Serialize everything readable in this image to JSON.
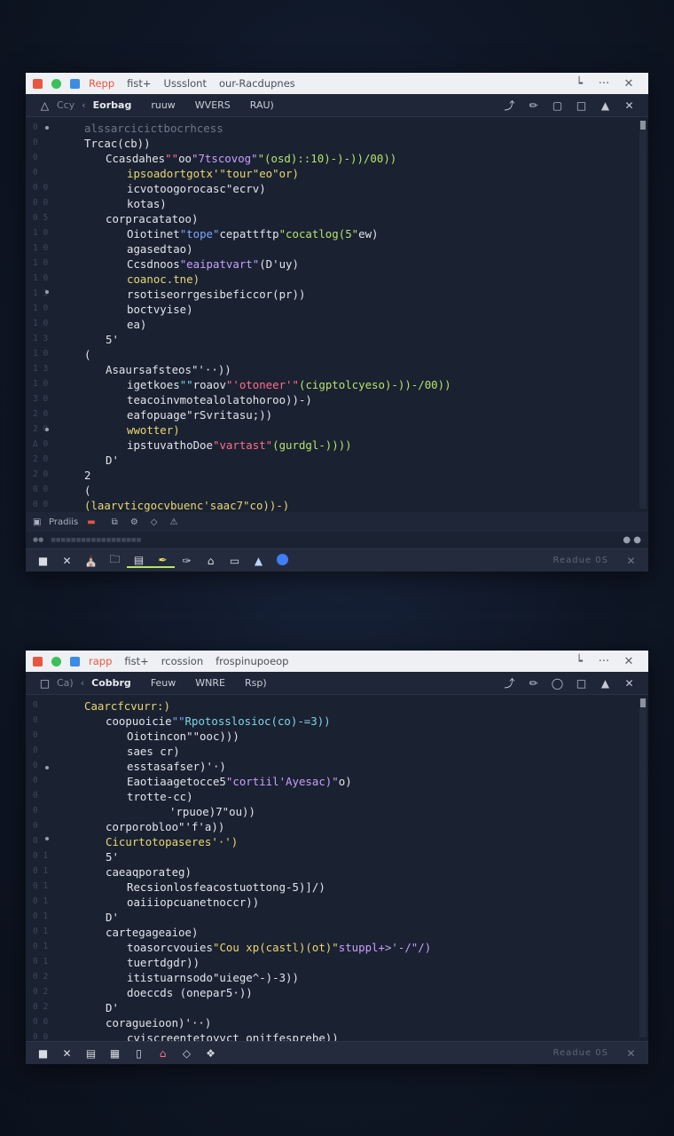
{
  "colors": {
    "background": "#0f1726",
    "titlebar": "#eef0f3",
    "editor": "#1a2131",
    "accent_blue": "#3f7ef5",
    "tab_red": "#e8563f",
    "tab_green": "#3cc05a",
    "tab_blue": "#3a8de0"
  },
  "window1": {
    "titlebar": {
      "tab1": "Repp",
      "tab2": "fist+",
      "tab3": "Ussslont",
      "tab4": "our-Racdupnes",
      "icons": [
        "minimize-icon",
        "more-icon",
        "close-icon"
      ]
    },
    "toolbar": {
      "item0": "Ccy",
      "item1": "Eorbag",
      "item2": "ruuw",
      "item3": "WVERS",
      "item4": "RAU)",
      "icons": [
        "arrow-icon",
        "brush-icon",
        "square-icon",
        "window-icon",
        "bell-icon",
        "close-icon"
      ]
    },
    "code": [
      {
        "indent": 0,
        "text": "alssarcicictbocrhcess",
        "cls": "c-dim"
      },
      {
        "indent": 0,
        "text": "Trcac(cb))",
        "cls": ""
      },
      {
        "indent": 1,
        "text": "Ccasdahes\"\"oo\"7tscovog\"\"(osd)::10)-)-))/00))",
        "cls": "mixed1"
      },
      {
        "indent": 2,
        "text": "ipsoadortgotx'\"tour\"eo\"or)",
        "cls": "c-yellow"
      },
      {
        "indent": 2,
        "text": "icvotoogorocasc\"ecrv)",
        "cls": ""
      },
      {
        "indent": 2,
        "text": "kotas)",
        "cls": ""
      },
      {
        "indent": 1,
        "text": "corpracatatoo)",
        "cls": ""
      },
      {
        "indent": 2,
        "text": "Oiotinet\"tope\"cepattftp\"cocatlog(5\"ew)",
        "cls": "mixed2"
      },
      {
        "indent": 2,
        "text": "agasedtao)",
        "cls": ""
      },
      {
        "indent": 2,
        "text": "Ccsdnoos\"eaipatvart\"(D'uy)",
        "cls": "mixed3"
      },
      {
        "indent": 2,
        "text": "coanoc.tne)",
        "cls": "c-yellow"
      },
      {
        "indent": 2,
        "text": "rsotiseorrgesibeficcor(pr))",
        "cls": "mixed4"
      },
      {
        "indent": 2,
        "text": "boctvyise)",
        "cls": ""
      },
      {
        "indent": 2,
        "text": "ea)",
        "cls": ""
      },
      {
        "indent": 1,
        "text": "5'",
        "cls": ""
      },
      {
        "indent": 0,
        "text": "(",
        "cls": ""
      },
      {
        "indent": 1,
        "text": "Asaursafsteos\"'··))",
        "cls": ""
      },
      {
        "indent": 2,
        "text": "igetkoes\"\"roaov\"'otoneer'\"(cigptolcyeso)-))-/00))",
        "cls": "mixed5"
      },
      {
        "indent": 2,
        "text": "teacoinvmotealolatohoroo))-)",
        "cls": ""
      },
      {
        "indent": 2,
        "text": "eafopuage\"rSvritasu;))",
        "cls": "mixed6"
      },
      {
        "indent": 2,
        "text": "wwotter)",
        "cls": "c-yellow"
      },
      {
        "indent": 2,
        "text": "ipstuvathoDoe\"vartast\"(gurdgl-))))",
        "cls": "mixed7"
      },
      {
        "indent": 1,
        "text": "D'",
        "cls": ""
      },
      {
        "indent": 0,
        "text": "2",
        "cls": ""
      },
      {
        "indent": 0,
        "text": "(",
        "cls": ""
      },
      {
        "indent": 0,
        "text": "(laarvticgocvbuenc'saac7\"co))-)",
        "cls": "c-yellow"
      }
    ],
    "line_numbers": [
      "0",
      "0",
      "0",
      "0",
      "0 0",
      "0 0",
      "0 5",
      "1 0",
      "1 0",
      "1 0",
      "1 0",
      "1 3",
      "1 0",
      "1 0",
      "1 3",
      "1 0",
      "1 3",
      "1 0",
      "3 0",
      "2 0",
      "2 0",
      "Δ 0",
      "2 0",
      "2 0",
      "0 0",
      "0 0"
    ],
    "status_label": "Pradiis",
    "status_sub": "■■■■■■■■■■■■■■■■■■",
    "bottom_status": "Readue 0S"
  },
  "window2": {
    "titlebar": {
      "tab1": "rapp",
      "tab2": "fist+",
      "tab3": "rcossion",
      "tab4": "frospinupoeop"
    },
    "toolbar": {
      "item0": "Ca)",
      "item1": "Cobbrg",
      "item2": "Feuw",
      "item3": "WNRE",
      "item4": "Rsp)"
    },
    "code": [
      {
        "indent": 0,
        "text": "Caarcfcvurr:)",
        "cls": "c-yellow"
      },
      {
        "indent": 1,
        "text": "coopuoicie\"\"Rpotosslosioc(co)-=3))",
        "cls": "mixed8"
      },
      {
        "indent": 2,
        "text": "Oiotincon\"\"ooc)))",
        "cls": ""
      },
      {
        "indent": 2,
        "text": "saes cr)",
        "cls": ""
      },
      {
        "indent": 2,
        "text": "esstasafser)'·)",
        "cls": ""
      },
      {
        "indent": 2,
        "text": "Eaotiaagetocce5\"cortiil'Ayesac)\"o)",
        "cls": "mixed9"
      },
      {
        "indent": 2,
        "text": "trotte-cc)",
        "cls": ""
      },
      {
        "indent": 4,
        "text": "'rpuoe)7\"ou))",
        "cls": ""
      },
      {
        "indent": 1,
        "text": "corporobloo\"'f'a))",
        "cls": "mixed10"
      },
      {
        "indent": 1,
        "text": "Cicurtotopaseres'·')",
        "cls": "c-yellow"
      },
      {
        "indent": 1,
        "text": "5'",
        "cls": ""
      },
      {
        "indent": 1,
        "text": "caeaqporateg)",
        "cls": ""
      },
      {
        "indent": 2,
        "text": "Recsionlosfeacostuottong-5)]/)",
        "cls": "mixed11"
      },
      {
        "indent": 2,
        "text": "oaiiiopcuanetnoccr))",
        "cls": ""
      },
      {
        "indent": 1,
        "text": "D'",
        "cls": ""
      },
      {
        "indent": 1,
        "text": "cartegageaioe)",
        "cls": ""
      },
      {
        "indent": 2,
        "text": "toasorcvouies\"Cou xp(castl)(ot)\"stuppl+>'-/\"/)",
        "cls": "mixed12"
      },
      {
        "indent": 2,
        "text": "tuertdgdr))",
        "cls": ""
      },
      {
        "indent": 2,
        "text": "itistuarnsodo\"uiege^-)-3))",
        "cls": ""
      },
      {
        "indent": 2,
        "text": "doeccds (onepar5·))",
        "cls": ""
      },
      {
        "indent": 1,
        "text": "D'",
        "cls": ""
      },
      {
        "indent": 1,
        "text": "coragueioon)'··)",
        "cls": ""
      },
      {
        "indent": 2,
        "text": "cviscreentetoyvct onitfesprebe))",
        "cls": ""
      }
    ],
    "line_numbers": [
      "0",
      "0",
      "0",
      "0",
      "0",
      "0",
      "0",
      "0",
      "0",
      "0",
      "0 1",
      "0 1",
      "0 1",
      "0 1",
      "0 1",
      "0 1",
      "0 1",
      "0 1",
      "0 2",
      "0 2",
      "0 2",
      "0 0",
      "0 0",
      "0 0"
    ],
    "bottom_status": "Readue 0S"
  }
}
